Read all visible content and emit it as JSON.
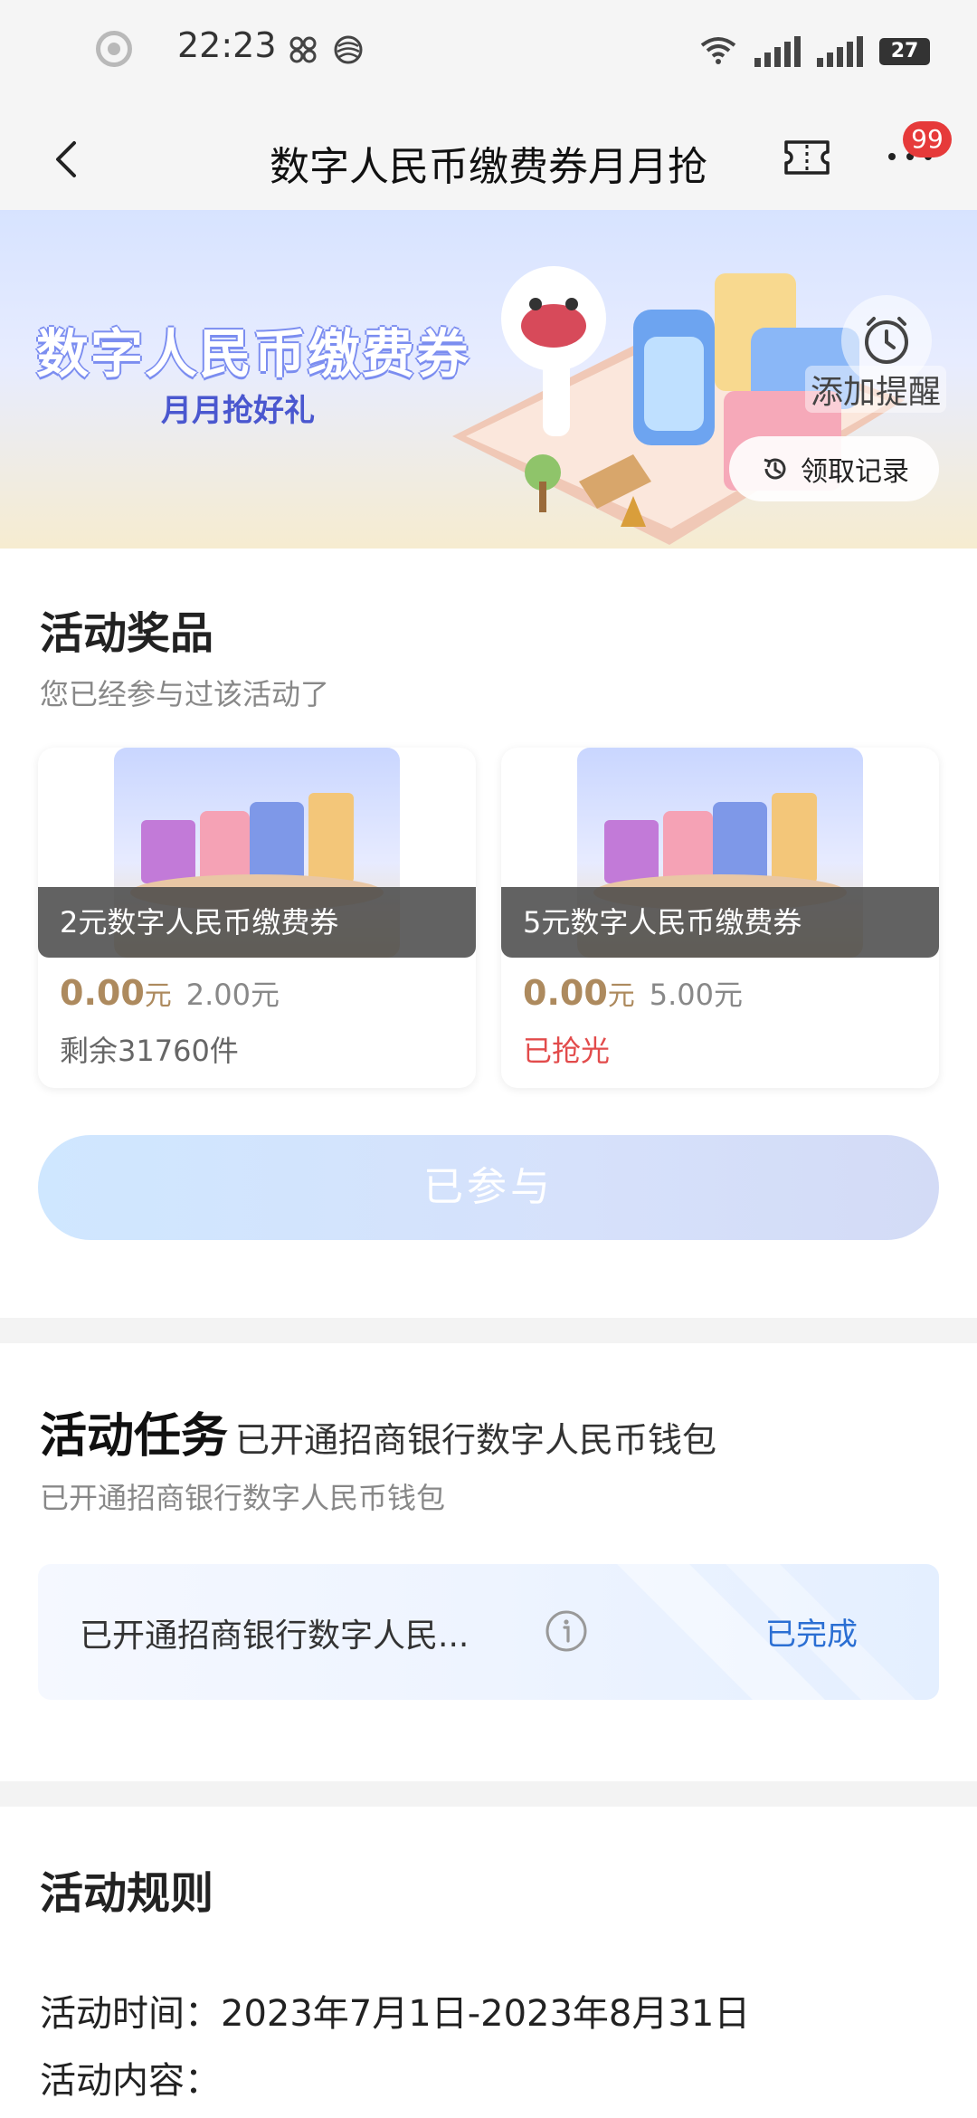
{
  "status_bar": {
    "time": "22:23",
    "battery": "27",
    "icons": [
      "circle-icon",
      "link-icon",
      "carrier-icon",
      "wifi-icon",
      "signal-icon",
      "signal-2-icon",
      "battery-icon"
    ]
  },
  "nav": {
    "title": "数字人民币缴费券月月抢",
    "badge": "99"
  },
  "banner": {
    "title": "数字人民币缴费券",
    "subtitle": "月月抢好礼",
    "remind_label": "添加提醒",
    "record_label": "领取记录"
  },
  "prizes": {
    "title": "活动奖品",
    "subtitle": "您已经参与过该活动了",
    "items": [
      {
        "name": "2元数字人民币缴费券",
        "price_now": "0.00",
        "unit": "元",
        "price_old": "2.00元",
        "remain": "剩余31760件"
      },
      {
        "name": "5元数字人民币缴费券",
        "price_now": "0.00",
        "unit": "元",
        "price_old": "5.00元",
        "remain": "已抢光"
      }
    ],
    "button": "已参与"
  },
  "tasks": {
    "title": "活动任务",
    "title_sub": "已开通招商银行数字人民币钱包",
    "subtitle": "已开通招商银行数字人民币钱包",
    "row_text": "已开通招商银行数字人民...",
    "row_status": "已完成"
  },
  "rules": {
    "title": "活动规则",
    "time_line": "活动时间：2023年7月1日-2023年8月31日",
    "content_line": "活动内容："
  },
  "colors": {
    "accent_price": "#ad8a5e",
    "soldout": "#e24b4b",
    "link_blue": "#2b6fd3",
    "badge_red": "#e63a3a"
  }
}
